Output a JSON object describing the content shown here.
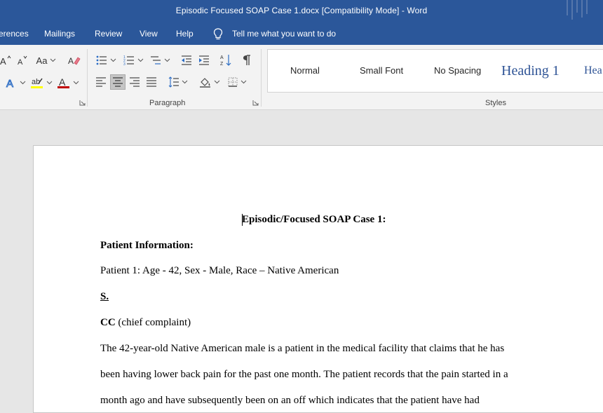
{
  "window": {
    "title": "Episodic Focused SOAP Case 1.docx [Compatibility Mode]  -  Word"
  },
  "tabs": [
    {
      "label": "erences"
    },
    {
      "label": "Mailings"
    },
    {
      "label": "Review"
    },
    {
      "label": "View"
    },
    {
      "label": "Help"
    }
  ],
  "tell_me": {
    "placeholder": "Tell me what you want to do"
  },
  "ribbon": {
    "font_group": {
      "change_case_label": "Aa"
    },
    "paragraph_group": {
      "label": "Paragraph"
    },
    "styles_group": {
      "label": "Styles",
      "items": [
        {
          "label": "Normal"
        },
        {
          "label": "Small Font"
        },
        {
          "label": "No Spacing"
        },
        {
          "label": "Heading 1"
        },
        {
          "label": "Hea"
        }
      ]
    },
    "colors": {
      "highlight": "#ffff00",
      "font_color": "#c00000"
    }
  },
  "document": {
    "title": "Episodic/Focused SOAP Case 1:",
    "patient_info_heading": "Patient Information:",
    "patient_line": "Patient 1: Age - 42, Sex - Male, Race – Native American",
    "section_s": "S.",
    "cc_label": "CC",
    "cc_text": " (chief complaint)",
    "paragraph_lines": [
      "The 42-year-old Native American male is a patient in the medical facility that claims that he has",
      "been having lower back pain for the past one month. The patient records that the pain started in a",
      "month ago and have subsequently been on an off which indicates that the patient have had"
    ]
  }
}
